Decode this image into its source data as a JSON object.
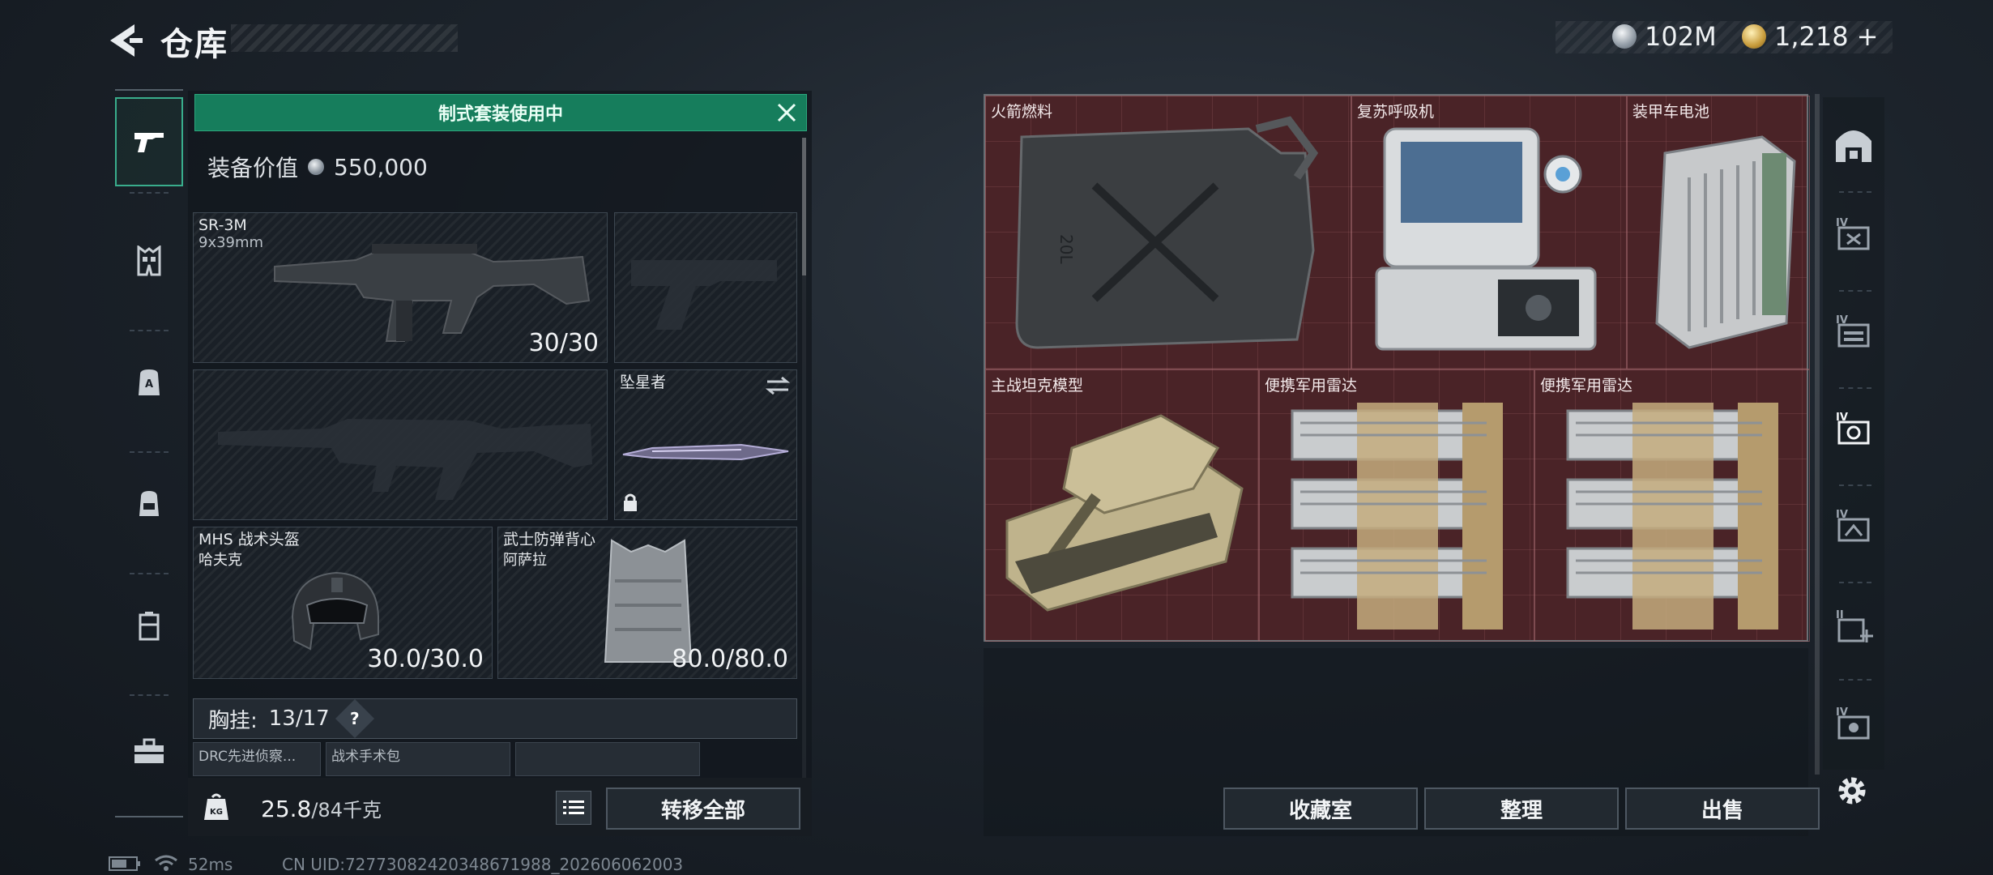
{
  "header": {
    "title": "仓库"
  },
  "currency": [
    {
      "name": "silver-coin",
      "amount": "102M"
    },
    {
      "name": "gold-coin",
      "amount": "1,218"
    }
  ],
  "currency_add": "+",
  "left_nav": [
    "pistol-icon",
    "vest-icon",
    "backpack-a-icon",
    "backpack-icon",
    "case-icon",
    "toolbox-icon"
  ],
  "equipment": {
    "banner": "制式套装使用中",
    "value_label": "装备价值",
    "value": "550,000",
    "slots": {
      "primary": {
        "name": "SR-3M",
        "caliber": "9x39mm",
        "ammo": "30/30"
      },
      "melee": {
        "name": "坠星者"
      },
      "helmet": {
        "name": "MHS 战术头盔",
        "variant": "哈夫克",
        "durability": "30.0/30.0"
      },
      "armor": {
        "name": "武士防弹背心",
        "variant": "阿萨拉",
        "durability": "80.0/80.0"
      }
    },
    "chest_rig": {
      "label": "胸挂:",
      "value": "13/17",
      "help": "?"
    },
    "rig_items": [
      "DRC先进侦察...",
      "战术手术包"
    ],
    "weight": {
      "current": "25.8",
      "max": "/84千克"
    },
    "transfer_all": "转移全部"
  },
  "storage": {
    "items": [
      {
        "name": "火箭燃料"
      },
      {
        "name": "复苏呼吸机"
      },
      {
        "name": "装甲车电池"
      },
      {
        "name": "主战坦克模型"
      },
      {
        "name": "便携军用雷达"
      },
      {
        "name": "便携军用雷达"
      }
    ],
    "buttons": {
      "collection": "收藏室",
      "sort": "整理",
      "sell": "出售"
    }
  },
  "right_nav": [
    "home-vault-icon",
    "storage-iv-icon",
    "storage-iv-b-icon",
    "storage-iv-active-icon",
    "storage-iv-c-icon",
    "storage-ii-add-icon",
    "storage-iv-d-icon",
    "settings-icon"
  ],
  "status_bar": {
    "ping": "52ms",
    "uid": "CN UID:727730824203486719​88_202606062003"
  },
  "colors": {
    "accent_green": "#167d5c",
    "storage_red": "#4a2327"
  }
}
